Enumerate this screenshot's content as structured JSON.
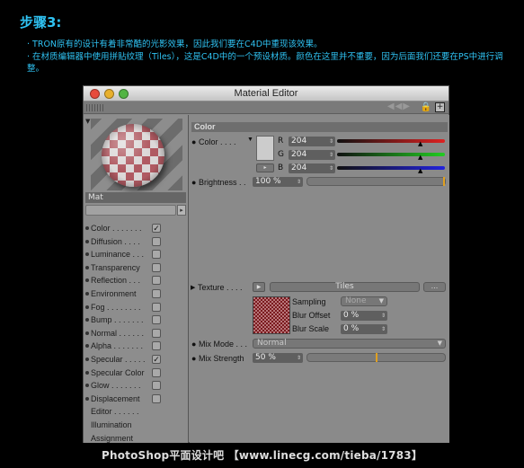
{
  "article": {
    "step_title": "步骤3:",
    "line1": "· TRON原有的设计有着非常酷的光影效果，因此我们要在C4D中重现该效果。",
    "line2": "· 在材质编辑器中使用拼贴纹理（Tiles），这是C4D中的一个预设材质。颜色在这里并不重要，因为后面我们还要在PS中进行调整。"
  },
  "window": {
    "title": "Material Editor"
  },
  "material": {
    "name": "Mat"
  },
  "channels": [
    {
      "label": "Color . . . . . . .",
      "checked": true,
      "has_box": true,
      "has_dot": true
    },
    {
      "label": "Diffusion . . . .",
      "checked": false,
      "has_box": true,
      "has_dot": true
    },
    {
      "label": "Luminance . . .",
      "checked": false,
      "has_box": true,
      "has_dot": true
    },
    {
      "label": "Transparency",
      "checked": false,
      "has_box": true,
      "has_dot": true
    },
    {
      "label": "Reflection . . .",
      "checked": false,
      "has_box": true,
      "has_dot": true
    },
    {
      "label": "Environment",
      "checked": false,
      "has_box": true,
      "has_dot": true
    },
    {
      "label": "Fog . . . . . . . .",
      "checked": false,
      "has_box": true,
      "has_dot": true
    },
    {
      "label": "Bump . . . . . . .",
      "checked": false,
      "has_box": true,
      "has_dot": true
    },
    {
      "label": "Normal . . . . . .",
      "checked": false,
      "has_box": true,
      "has_dot": true
    },
    {
      "label": "Alpha . . . . . . .",
      "checked": false,
      "has_box": true,
      "has_dot": true
    },
    {
      "label": "Specular . . . . .",
      "checked": true,
      "has_box": true,
      "has_dot": true
    },
    {
      "label": "Specular Color",
      "checked": false,
      "has_box": true,
      "has_dot": true
    },
    {
      "label": "Glow . . . . . . .",
      "checked": false,
      "has_box": true,
      "has_dot": true
    },
    {
      "label": "Displacement",
      "checked": false,
      "has_box": true,
      "has_dot": true
    },
    {
      "label": "Editor . . . . . .",
      "checked": false,
      "has_box": false,
      "has_dot": false
    },
    {
      "label": "Illumination",
      "checked": false,
      "has_box": false,
      "has_dot": false
    },
    {
      "label": "Assignment",
      "checked": false,
      "has_box": false,
      "has_dot": false
    }
  ],
  "color_panel": {
    "section": "Color",
    "color_label": "Color . . . .",
    "r_label": "R",
    "r_value": "204",
    "g_label": "G",
    "g_value": "204",
    "b_label": "B",
    "b_value": "204",
    "brightness_label": "Brightness . .",
    "brightness_value": "100 %",
    "brightness": 1.0,
    "texture_label": "Texture . . . .",
    "texture_name": "Tiles",
    "texture_more": "...",
    "sampling_label": "Sampling",
    "sampling_value": "None",
    "blur_offset_label": "Blur Offset",
    "blur_offset_value": "0 %",
    "blur_scale_label": "Blur Scale",
    "blur_scale_value": "0 %",
    "mix_mode_label": "Mix Mode . . .",
    "mix_mode_value": "Normal",
    "mix_strength_label": "Mix Strength",
    "mix_strength_value": "50 %",
    "mix_strength": 0.5
  },
  "colors": {
    "accent_text": "#2fc2f2",
    "swatch": "#cccccc",
    "slider_marker": "#e0a020"
  },
  "watermark": "PhotoShop平面设计吧 【www.linecg.com/tieba/1783】"
}
